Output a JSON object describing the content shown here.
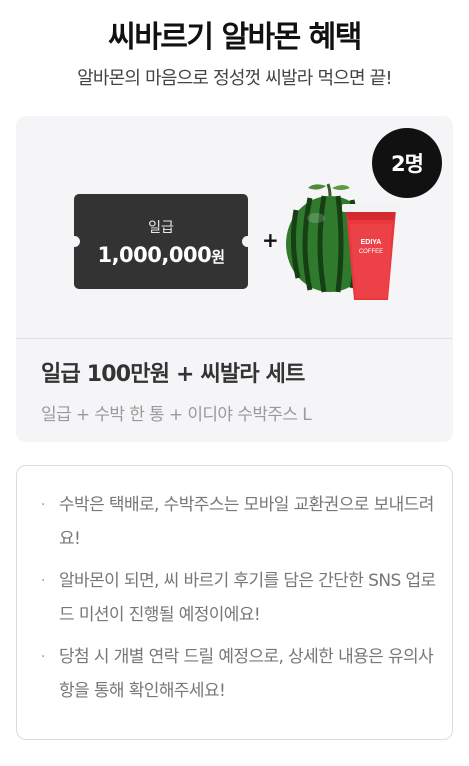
{
  "header": {
    "title": "씨바르기 알바몬 혜택",
    "subtitle": "알바몬의 마음으로 정성껏 씨발라 먹으면 끝!"
  },
  "prize": {
    "badge": "2명",
    "ticket_label": "일급",
    "ticket_amount": "1,000,000",
    "ticket_unit": "원",
    "plus": "+",
    "cup_brand_line1": "EDIYA",
    "cup_brand_line2": "COFFEE",
    "name": "일급 100만원 + 씨발라 세트",
    "detail": "일급 + 수박 한 통 + 이디야 수박주스 L"
  },
  "notes": {
    "bullet": "·",
    "items": [
      "수박은 택배로, 수박주스는 모바일 교환권으로 보내드려요!",
      "알바몬이 되면, 씨 바르기 후기를 담은 간단한 SNS 업로드 미션이 진행될 예정이에요!",
      "당첨 시 개별 연락 드릴 예정으로, 상세한 내용은 유의사항을 통해 확인해주세요!"
    ]
  },
  "colors": {
    "card_bg": "#f5f5f7",
    "ticket_bg": "#333333",
    "badge_bg": "#111111",
    "cup_red": "#e8373d",
    "watermelon_green": "#2f7a2d"
  }
}
